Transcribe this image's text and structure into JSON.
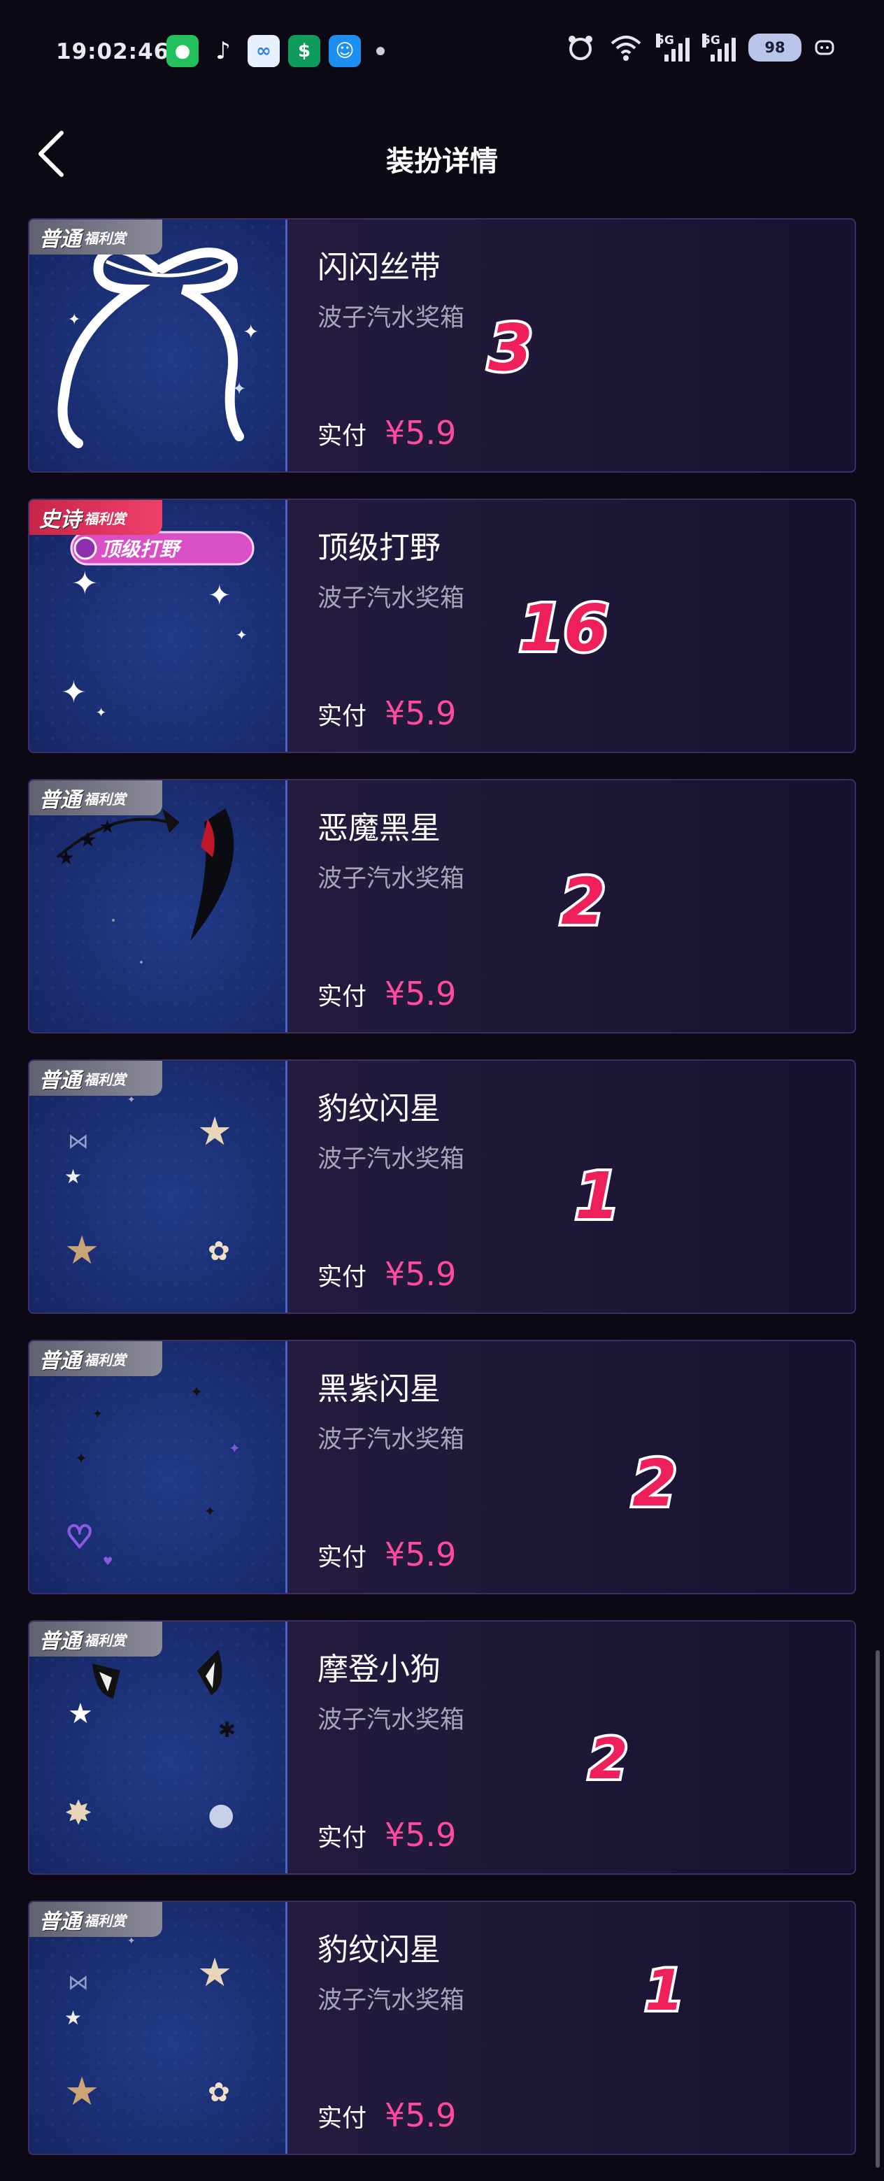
{
  "status_bar": {
    "time": "19:02:46",
    "network_labels": [
      "5G",
      "5G"
    ],
    "battery": "98"
  },
  "nav": {
    "title": "装扮详情",
    "back_icon": "chevron-left-icon"
  },
  "items": [
    {
      "tier_main": "普通",
      "tier_sub": "福利赏",
      "tier_type": "common",
      "name": "闪闪丝带",
      "source": "波子汽水奖箱",
      "paid_label": "实付",
      "price": "¥5.9",
      "count": "3"
    },
    {
      "tier_main": "史诗",
      "tier_sub": "福利赏",
      "tier_type": "epic",
      "name": "顶级打野",
      "source": "波子汽水奖箱",
      "paid_label": "实付",
      "price": "¥5.9",
      "count": "16",
      "badge_text": "顶级打野"
    },
    {
      "tier_main": "普通",
      "tier_sub": "福利赏",
      "tier_type": "common",
      "name": "恶魔黑星",
      "source": "波子汽水奖箱",
      "paid_label": "实付",
      "price": "¥5.9",
      "count": "2"
    },
    {
      "tier_main": "普通",
      "tier_sub": "福利赏",
      "tier_type": "common",
      "name": "豹纹闪星",
      "source": "波子汽水奖箱",
      "paid_label": "实付",
      "price": "¥5.9",
      "count": "1"
    },
    {
      "tier_main": "普通",
      "tier_sub": "福利赏",
      "tier_type": "common",
      "name": "黑紫闪星",
      "source": "波子汽水奖箱",
      "paid_label": "实付",
      "price": "¥5.9",
      "count": "2"
    },
    {
      "tier_main": "普通",
      "tier_sub": "福利赏",
      "tier_type": "common",
      "name": "摩登小狗",
      "source": "波子汽水奖箱",
      "paid_label": "实付",
      "price": "¥5.9",
      "count": "2"
    },
    {
      "tier_main": "普通",
      "tier_sub": "福利赏",
      "tier_type": "common",
      "name": "豹纹闪星",
      "source": "波子汽水奖箱",
      "paid_label": "实付",
      "price": "¥5.9",
      "count": "1"
    }
  ],
  "colors": {
    "price": "#ff4aa0",
    "count": "#ee1f5a",
    "background": "#0c0914"
  }
}
